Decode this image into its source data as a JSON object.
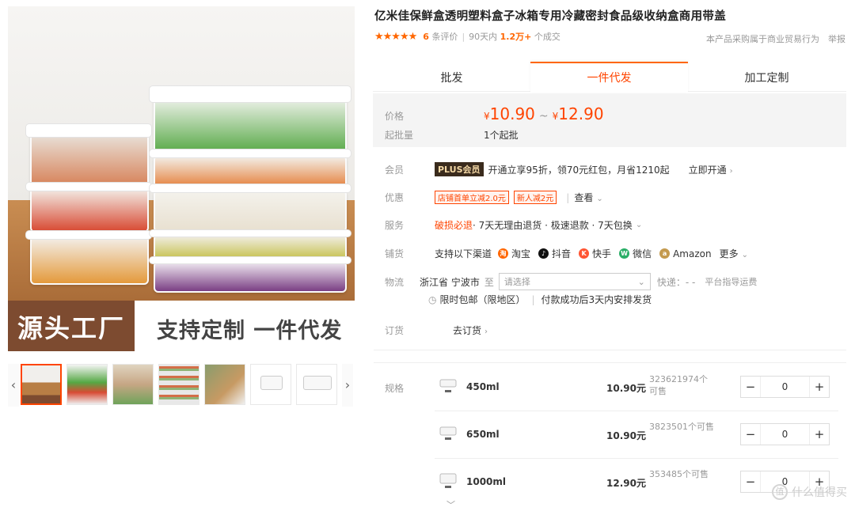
{
  "hero": {
    "tag_left": "源头工厂",
    "tag_right": "支持定制 一件代发"
  },
  "product": {
    "title": "亿米佳保鲜盒透明塑料盒子冰箱专用冷藏密封食品级收纳盒商用带盖",
    "rating": {
      "stars": "★★★★★",
      "review_count": "6",
      "review_label": "条评价",
      "sold_prefix": "90天内",
      "sold_value": "1.2万+",
      "sold_suffix": "个成交"
    },
    "notice": "本产品采购属于商业贸易行为",
    "report": "举报"
  },
  "tabs": [
    "批发",
    "一件代发",
    "加工定制"
  ],
  "price": {
    "label": "价格",
    "currency": "¥",
    "low": "10.90",
    "tilde": "~",
    "high": "12.90",
    "min_label": "起批量",
    "min_value": "1个起批"
  },
  "member": {
    "label": "会员",
    "badge": "PLUS会员",
    "text": "开通立享95折，领70元红包，月省1210起",
    "link": "立即开通"
  },
  "promo": {
    "label": "优惠",
    "chip1": "店铺首单立减2.0元",
    "chip2": "新人减2元",
    "link": "查看"
  },
  "service": {
    "label": "服务",
    "highlight": "破损必退",
    "text": "· 7天无理由退货 · 极速退款 · 7天包换"
  },
  "channels": {
    "label": "铺货",
    "intro": "支持以下渠道",
    "items": [
      "淘宝",
      "抖音",
      "快手",
      "微信",
      "Amazon"
    ],
    "more": "更多"
  },
  "logistics": {
    "label": "物流",
    "from": "浙江省 宁波市",
    "to": "至",
    "placeholder": "请选择",
    "express": "快递：- -",
    "guide": "平台指导运费",
    "free": "限时包邮（限地区）",
    "ship": "付款成功后3天内安排发货"
  },
  "order": {
    "label": "订货",
    "link": "去订货"
  },
  "specs": {
    "label": "规格",
    "items": [
      {
        "name": "450ml",
        "price": "10.90元",
        "stock": "323621974个可售",
        "qty": "0"
      },
      {
        "name": "650ml",
        "price": "10.90元",
        "stock": "3823501个可售",
        "qty": "0"
      },
      {
        "name": "1000ml",
        "price": "12.90元",
        "stock": "353485个可售",
        "qty": "0"
      }
    ]
  },
  "stepper": {
    "minus": "−",
    "plus": "+"
  },
  "watermark": "什么值得买",
  "colors": {
    "accent": "#ff4400",
    "star": "#ff6600"
  }
}
